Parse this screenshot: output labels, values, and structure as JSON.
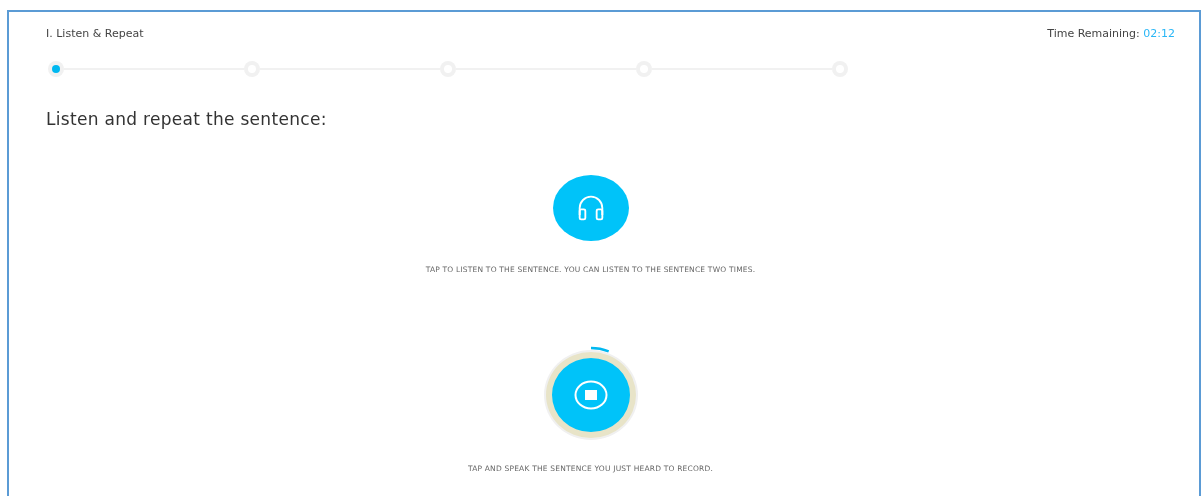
{
  "section_title": "I. Listen & Repeat",
  "timer": {
    "label": "Time Remaining:",
    "value": "02:12"
  },
  "steps": [
    {
      "selected": true
    },
    {
      "selected": false
    },
    {
      "selected": false
    },
    {
      "selected": false
    },
    {
      "selected": false
    }
  ],
  "prompt": "Listen and repeat the sentence:",
  "listen": {
    "instruction": "TAP TO LISTEN TO THE SENTENCE. YOU CAN LISTEN TO THE SENTENCE TWO TIMES."
  },
  "record": {
    "level": 0.06,
    "instruction": "TAP AND SPEAK THE SENTENCE YOU JUST HEARD TO RECORD."
  }
}
